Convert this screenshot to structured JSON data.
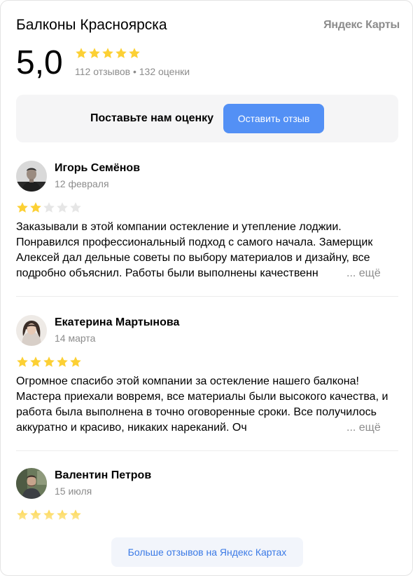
{
  "header": {
    "org_name": "Балконы Красноярска",
    "brand": "Яндекс Карты"
  },
  "rating": {
    "value": "5,0",
    "stars": 5,
    "meta": "112 отзывов • 132 оценки"
  },
  "cta": {
    "text": "Поставьте нам оценку",
    "button_label": "Оставить отзыв"
  },
  "reviews": [
    {
      "author": "Игорь Семёнов",
      "date": "12 февраля",
      "stars": 2,
      "text": "Заказывали в этой компании остекление и утепление лоджии. Понравился профессиональный подход с самого начала. Замерщик Алексей дал дельные советы по выбору материалов и дизайну, все подробно объяснил. Работы были выполнены качественн",
      "more_label": "... ещё"
    },
    {
      "author": "Екатерина Мартынова",
      "date": "14 марта",
      "stars": 5,
      "text": "Огромное спасибо этой компании за остекление нашего балкона! Мастера приехали вовремя, все материалы были высокого качества, и работа была выполнена в точно оговоренные сроки. Все получилось аккуратно и красиво, никаких нареканий. Оч",
      "more_label": "... ещё"
    },
    {
      "author": "Валентин Петров",
      "date": "15 июля",
      "stars": 5
    }
  ],
  "footer": {
    "more_reviews_label": "Больше отзывов на Яндекс Картах"
  },
  "colors": {
    "star_filled": "#fcd034",
    "star_empty": "#e6e6e6",
    "accent_button": "#5390f5",
    "link": "#3b7ae6"
  },
  "icons": {
    "star": "star-icon"
  }
}
